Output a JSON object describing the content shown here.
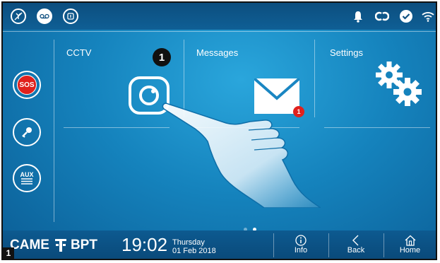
{
  "topbar": {
    "left_icons": [
      "mute-icon",
      "voicemail-icon",
      "do-not-disturb-icon"
    ],
    "right_icons": [
      "bell-icon",
      "link-icon",
      "check-icon",
      "wifi-icon"
    ]
  },
  "sidebar": {
    "sos_label": "SOS",
    "key_icon": "key-icon",
    "aux_label": "AUX"
  },
  "tiles": [
    {
      "label": "CCTV",
      "icon": "camera-icon"
    },
    {
      "label": "Messages",
      "icon": "envelope-icon",
      "badge": "1"
    },
    {
      "label": "Settings",
      "icon": "gears-icon"
    }
  ],
  "callout_marker": "1",
  "page_dots": {
    "count": 2,
    "active_index": 1
  },
  "bottombar": {
    "brand_came": "CAME",
    "brand_bpt": "BPT",
    "time": "19:02",
    "day": "Thursday",
    "date": "01 Feb 2018",
    "info_label": "Info",
    "back_label": "Back",
    "home_label": "Home"
  },
  "figure_number": "1",
  "colors": {
    "accent": "#1583bd",
    "sos_red": "#e0211d",
    "badge_red": "#e0211d"
  }
}
